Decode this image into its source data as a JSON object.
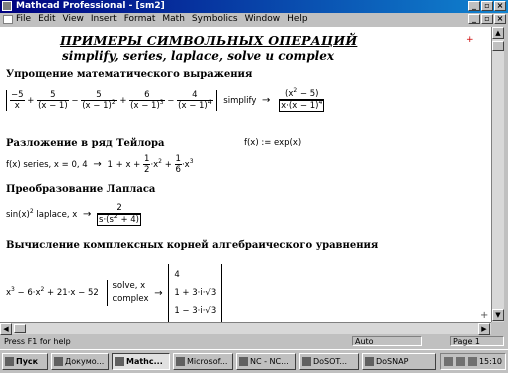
{
  "window": {
    "title": "Mathcad Professional - [sm2]",
    "btn_min": "_",
    "btn_max": "▫",
    "btn_close": "×"
  },
  "menu": {
    "items": [
      "File",
      "Edit",
      "View",
      "Insert",
      "Format",
      "Math",
      "Symbolics",
      "Window",
      "Help"
    ],
    "btn_min": "_",
    "btn_max": "▫",
    "btn_close": "×"
  },
  "doc": {
    "heading1": "ПРИМЕРЫ СИМВОЛЬНЫХ ОПЕРАЦИЙ",
    "heading2": "simplify, series, laplace, solve и complex",
    "sec1": "Упрощение математического выражения",
    "sec2": "Разложение в ряд Тейлора",
    "sec3": "Преобразование Лапласа",
    "sec4": "Вычисление комплексных корней алгебраического уравнения",
    "simplify_kw": "simplify",
    "taylor_def": "f(x) := exp(x)",
    "series_kw": "series, x = 0, 4",
    "laplace_kw": "laplace, x",
    "solve_kw": "solve, x",
    "complex_kw": "complex",
    "root1": "4",
    "root2": "1 + 3·i·√3",
    "root3": "1 − 3·i·√3"
  },
  "status": {
    "help": "Press F1 for help",
    "auto": "Auto",
    "page": "Page 1"
  },
  "taskbar": {
    "items": [
      "Пуск",
      "Докумо...",
      "Mathc...",
      "Microsof...",
      "NC - NC...",
      "DoSOT...",
      "DoSNAP"
    ],
    "clock": "15:10"
  }
}
